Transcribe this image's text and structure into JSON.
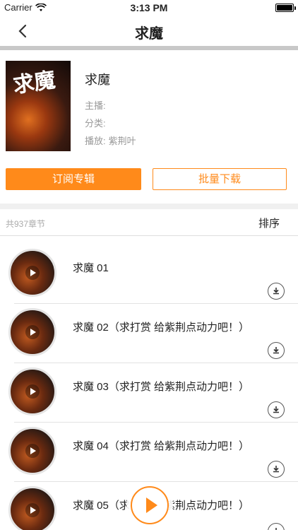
{
  "status_bar": {
    "carrier": "Carrier",
    "time": "3:13 PM"
  },
  "nav": {
    "title": "求魔"
  },
  "album": {
    "cover_text": "求魔",
    "name": "求魔",
    "host_label": "主播:",
    "host_value": "",
    "category_label": "分类:",
    "category_value": "",
    "narrator_label": "播放:",
    "narrator_value": "紫荆叶"
  },
  "actions": {
    "subscribe": "订阅专辑",
    "download": "批量下载"
  },
  "list_header": {
    "count": "共937章节",
    "sort": "排序"
  },
  "tracks": [
    {
      "title": "求魔 01"
    },
    {
      "title": "求魔 02（求打赏 给紫荆点动力吧！）"
    },
    {
      "title": "求魔 03（求打赏 给紫荆点动力吧！）"
    },
    {
      "title": "求魔 04（求打赏 给紫荆点动力吧！）"
    },
    {
      "title": "求魔 05（求打赏 给紫荆点动力吧！）"
    }
  ],
  "colors": {
    "accent": "#ff8a1a",
    "divider": "#c8c8c8"
  },
  "icons": {
    "back": "chevron-left-icon",
    "download": "download-icon",
    "play": "play-icon",
    "wifi": "wifi-icon",
    "battery": "battery-icon"
  }
}
